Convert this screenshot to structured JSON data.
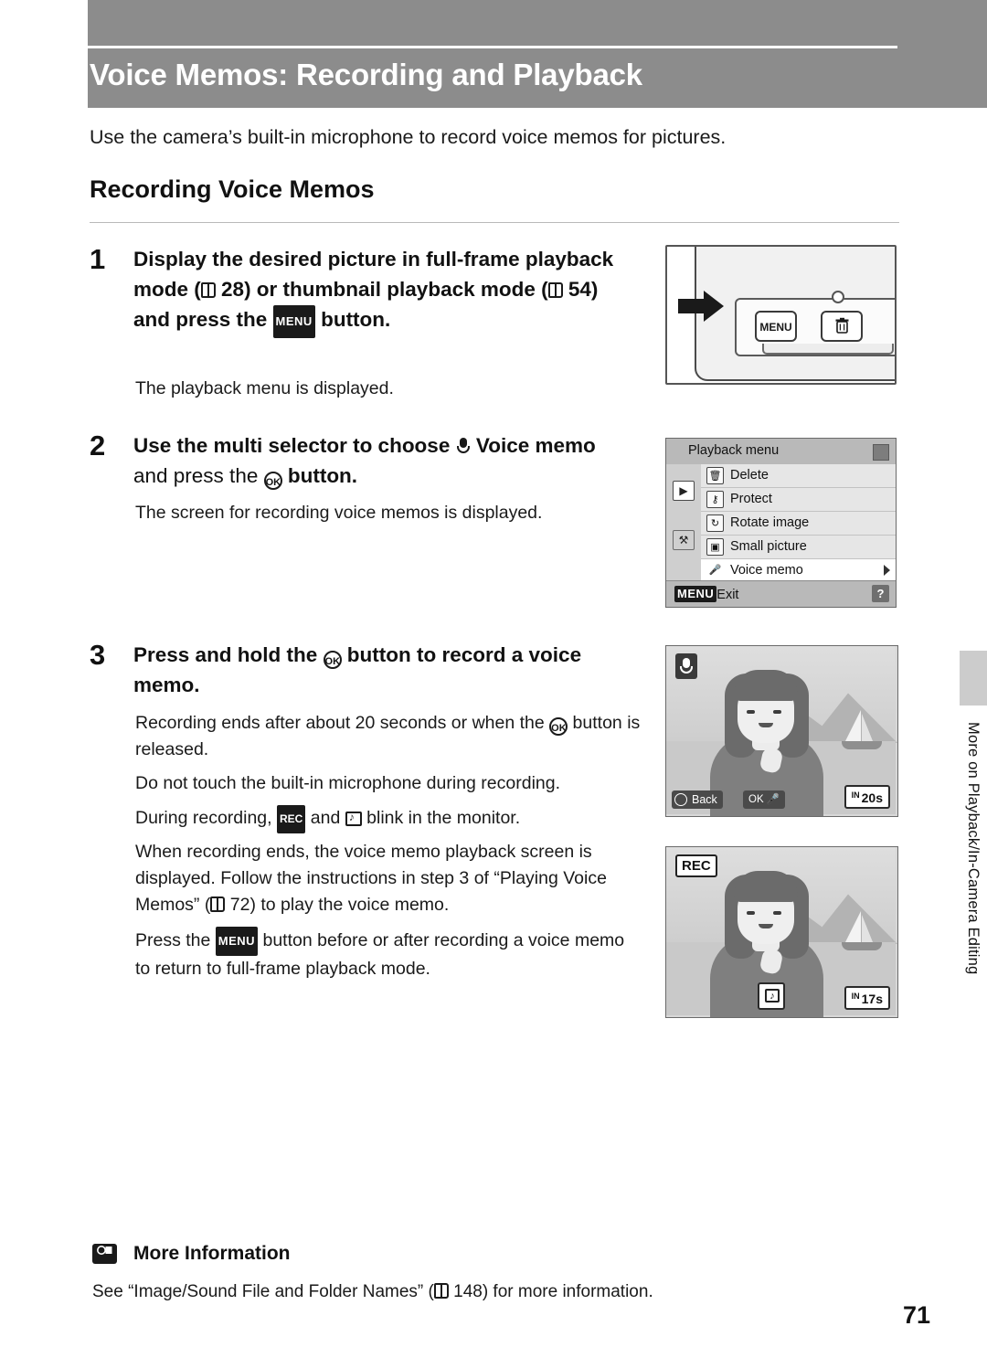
{
  "header": {
    "title": "Voice Memos: Recording and Playback"
  },
  "intro": "Use the camera’s built-in microphone to record voice memos for pictures.",
  "section_heading": "Recording Voice Memos",
  "steps": [
    {
      "number": "1",
      "title_parts": {
        "a": "Display the desired picture in full-frame playback mode (",
        "ref1": "28",
        "b": ") or thumbnail playback mode (",
        "ref2": "54",
        "c": ") and press the ",
        "menu": "MENU",
        "d": " button."
      },
      "body": "The playback menu is displayed."
    },
    {
      "number": "2",
      "title_parts": {
        "a": "Use the multi selector to choose ",
        "bold": "Voice memo",
        "b": " and press the ",
        "ok": "OK",
        "c": " button."
      },
      "body": "The screen for recording voice memos is displayed."
    },
    {
      "number": "3",
      "title_parts": {
        "a": "Press and hold the ",
        "ok": "OK",
        "b": " button to record a voice memo."
      },
      "paragraphs": [
        "Recording ends after about 20 seconds or when the Ⓚ button is released.",
        "Do not touch the built-in microphone during recording.",
        "During recording, Ⓡ and Ⓢ blink in the monitor.",
        "When recording ends, the voice memo playback screen is displayed. Follow the instructions in step 3 of “Playing Voice Memos” (📖 72) to play the voice memo.",
        "Press the MENU button before or after recording a voice memo to return to full-frame playback mode."
      ],
      "p1_a": "Recording ends after about 20 seconds or when the ",
      "p1_b": " button is released.",
      "p2": "Do not touch the built-in microphone during recording.",
      "p3_a": "During recording, ",
      "p3_rec": "REC",
      "p3_b": " and ",
      "p3_c": " blink in the monitor.",
      "p4_a": "When recording ends, the voice memo playback screen is displayed. Follow the instructions in step 3 of “Playing Voice Memos” (",
      "p4_ref": "72",
      "p4_b": ") to play the voice memo.",
      "p5_a": "Press the ",
      "p5_menu": "MENU",
      "p5_b": " button before or after recording a voice memo to return to full-frame playback mode."
    }
  ],
  "figures": {
    "camera": {
      "menu_button_label": "MENU",
      "macro_icon": "flower-icon",
      "delete_icon": "trash-icon"
    },
    "playback_menu": {
      "title": "Playback menu",
      "items": [
        {
          "label": "Delete",
          "icon": "trash-icon",
          "selected": false
        },
        {
          "label": "Protect",
          "icon": "key-icon",
          "selected": false
        },
        {
          "label": "Rotate image",
          "icon": "rotate-icon",
          "selected": false
        },
        {
          "label": "Small picture",
          "icon": "small-picture-icon",
          "selected": false
        },
        {
          "label": "Voice memo",
          "icon": "microphone-icon",
          "selected": true
        }
      ],
      "footer_label": "Exit",
      "footer_menu_glyph": "MENU",
      "help_glyph": "?",
      "tabs": [
        "playback-tab",
        "setup-tab"
      ]
    },
    "record_screen_1": {
      "back_label": "Back",
      "ok_label": "OK",
      "time_label": "20s",
      "time_prefix": "IN",
      "top_icon": "microphone-icon"
    },
    "record_screen_2": {
      "rec_badge": "REC",
      "time_label": "17s",
      "time_prefix": "IN",
      "center_icon": "speaker-icon"
    }
  },
  "side_tab": {
    "label": "More on Playback/In-Camera Editing"
  },
  "more_information": {
    "icon_label": "i",
    "title": "More Information",
    "text": "See “Image/Sound File and Folder Names” (📖 148) for more information.",
    "text_a": "See “Image/Sound File and Folder Names” (",
    "text_ref": "148",
    "text_b": ") for more information."
  },
  "page_number": "71",
  "colors": {
    "header_band": "#8c8c8c",
    "menu_titlebar": "#b9b9b9",
    "selected_row": "#ffffff",
    "side_tab": "#cccccc"
  }
}
